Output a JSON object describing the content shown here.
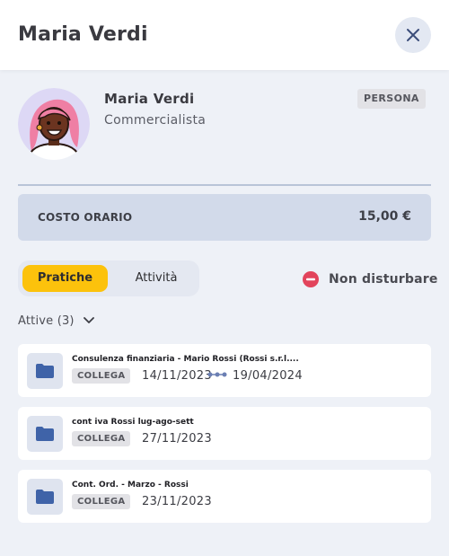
{
  "header": {
    "title": "Maria Verdi",
    "close_icon": "close-icon"
  },
  "profile": {
    "name": "Maria Verdi",
    "role": "Commercialista",
    "type_badge": "PERSONA",
    "avatar_icon": "avatar-woman-pink-hair"
  },
  "cost": {
    "label": "COSTO ORARIO",
    "value": "15,00 €"
  },
  "tabs": [
    {
      "label": "Pratiche",
      "active": true
    },
    {
      "label": "Attività",
      "active": false
    }
  ],
  "status": {
    "label": "Non disturbare",
    "icon": "do-not-disturb-icon",
    "color": "#e2445c"
  },
  "section": {
    "label": "Attive (3)",
    "icon": "chevron-down-icon"
  },
  "practices": [
    {
      "title": "Consulenza finanziaria - Mario Rossi (Rossi s.r.l....",
      "tag": "COLLEGA",
      "start_date": "14/11/2023",
      "end_date": "19/04/2024",
      "icon": "folder-icon"
    },
    {
      "title": "cont iva Rossi lug-ago-sett",
      "tag": "COLLEGA",
      "start_date": "27/11/2023",
      "icon": "folder-icon"
    },
    {
      "title": "Cont. Ord. - Marzo - Rossi",
      "tag": "COLLEGA",
      "start_date": "23/11/2023",
      "icon": "folder-icon"
    }
  ],
  "colors": {
    "accent": "#fcc20c",
    "folder": "#3f63a8",
    "background": "#eef1f7"
  }
}
